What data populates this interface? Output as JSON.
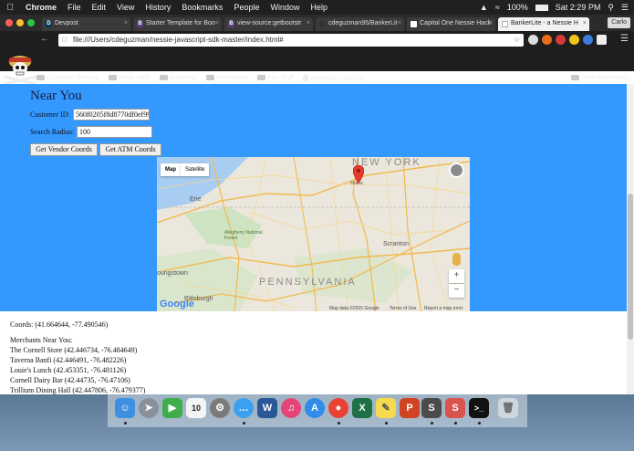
{
  "menubar": {
    "app": "Chrome",
    "items": [
      "File",
      "Edit",
      "View",
      "History",
      "Bookmarks",
      "People",
      "Window",
      "Help"
    ],
    "battery": "100%",
    "clock": "Sat 2:29 PM"
  },
  "tabs": [
    {
      "label": "Devpost",
      "fav": "D",
      "color": "#003e54"
    },
    {
      "label": "Starter Template for Boo",
      "fav": "B",
      "color": "#563d7c"
    },
    {
      "label": "view-source:getbootstr",
      "fav": "B",
      "color": "#563d7c"
    },
    {
      "label": "cdeguzman95/BankerLit",
      "fav": "",
      "color": "#333333"
    },
    {
      "label": "Capital One Nessie Hack",
      "fav": "",
      "color": "#ffffff"
    },
    {
      "label": "BankerLite - a Nessie H",
      "fav": "",
      "color": "#ffffff"
    }
  ],
  "profile": "Carlo",
  "address": "file:///Users/cdeguzman/nessie-javascript-sdk-master/index.html#",
  "bookmarks": [
    "Computer Science",
    "Texas A&M",
    "Academic",
    "Information",
    "Fun Stuff",
    "+Remove Login fro"
  ],
  "other_bookmarks": "Other Bookmarks",
  "page": {
    "title": "Near You",
    "customer_label": "Customer ID:",
    "customer_value": "560f0205f8d8770df0ef99",
    "radius_label": "Search Radius:",
    "radius_value": "100",
    "btn_vendor": "Get Vendor Coords",
    "btn_atm": "Get ATM Coords"
  },
  "map": {
    "type_map": "Map",
    "type_sat": "Satellite",
    "labels": {
      "newyork": "NEW YORK",
      "ithaca": "Ithaca",
      "erie": "Erie",
      "allegheny": "Allegheny National Forest",
      "scranton": "Scranton",
      "youngstown": "oungstown",
      "pittsburgh": "Pittsburgh",
      "pennsylvania": "PENNSYLVANIA"
    },
    "google": "Google",
    "attribution": [
      "Map data ©2015 Google",
      "Terms of Use",
      "Report a map error"
    ],
    "zoom_in": "+",
    "zoom_out": "−"
  },
  "results": {
    "coords": "Coords: (41.664644, -77.490546)",
    "merchants_header": "Merchants Near You:",
    "merchants": [
      "The Cornell Store (42.446734, -76.484649)",
      "Taverna Banfi (42.446491, -76.482226)",
      "Louie's Lunch (42.453351, -76.481126)",
      "Cornell Dairy Bar (42.44735, -76.47106)",
      "Trillium Dining Hall (42.447806, -76.479377)"
    ]
  }
}
